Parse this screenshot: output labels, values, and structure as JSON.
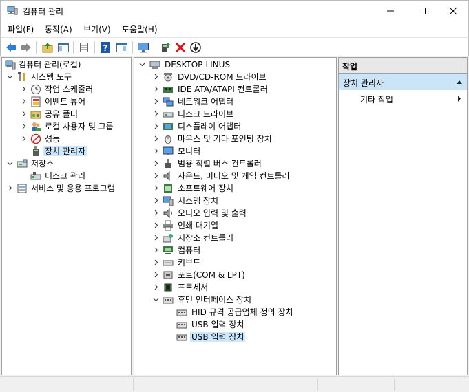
{
  "window": {
    "title": "컴퓨터 관리",
    "controls": [
      "minimize",
      "maximize",
      "close"
    ]
  },
  "menu": [
    {
      "label": "파일(F)"
    },
    {
      "label": "동작(A)"
    },
    {
      "label": "보기(V)"
    },
    {
      "label": "도움말(H)"
    }
  ],
  "toolbar": {
    "buttons": [
      "back-icon",
      "forward-icon",
      "up-icon",
      "show-hide-console-tree-icon",
      "export-list-icon",
      "help-icon",
      "show-action-pane-icon",
      "monitor-icon",
      "update-driver-icon",
      "uninstall-icon",
      "disable-device-icon"
    ]
  },
  "left_tree": [
    {
      "label": "컴퓨터 관리(로컬)",
      "icon": "computer-management-icon"
    },
    {
      "label": "시스템 도구",
      "icon": "tools-icon"
    },
    {
      "label": "작업 스케줄러",
      "icon": "clock-icon"
    },
    {
      "label": "이벤트 뷰어",
      "icon": "event-viewer-icon"
    },
    {
      "label": "공유 폴더",
      "icon": "shared-folder-icon"
    },
    {
      "label": "로컬 사용자 및 그룹",
      "icon": "users-icon"
    },
    {
      "label": "성능",
      "icon": "performance-icon"
    },
    {
      "label": "장치 관리자",
      "icon": "device-manager-icon",
      "selected": true
    },
    {
      "label": "저장소",
      "icon": "storage-icon"
    },
    {
      "label": "디스크 관리",
      "icon": "disk-management-icon"
    },
    {
      "label": "서비스 및 응용 프로그램",
      "icon": "services-icon"
    }
  ],
  "device_tree": {
    "root": "DESKTOP-LINUS",
    "categories": [
      {
        "label": "DVD/CD-ROM 드라이브",
        "icon": "dvd-drive-icon"
      },
      {
        "label": "IDE ATA/ATAPI 컨트롤러",
        "icon": "ide-controller-icon"
      },
      {
        "label": "네트워크 어댑터",
        "icon": "network-adapter-icon"
      },
      {
        "label": "디스크 드라이브",
        "icon": "disk-drive-icon"
      },
      {
        "label": "디스플레이 어댑터",
        "icon": "display-adapter-icon"
      },
      {
        "label": "마우스 및 기타 포인팅 장치",
        "icon": "mouse-icon"
      },
      {
        "label": "모니터",
        "icon": "monitor-icon"
      },
      {
        "label": "범용 직렬 버스 컨트롤러",
        "icon": "usb-controller-icon"
      },
      {
        "label": "사운드, 비디오 및 게임 컨트롤러",
        "icon": "speaker-icon"
      },
      {
        "label": "소프트웨어 장치",
        "icon": "software-device-icon"
      },
      {
        "label": "시스템 장치",
        "icon": "system-device-icon"
      },
      {
        "label": "오디오 입력 및 출력",
        "icon": "audio-io-icon"
      },
      {
        "label": "인쇄 대기열",
        "icon": "printer-icon"
      },
      {
        "label": "저장소 컨트롤러",
        "icon": "storage-controller-icon"
      },
      {
        "label": "컴퓨터",
        "icon": "computer-icon"
      },
      {
        "label": "키보드",
        "icon": "keyboard-icon"
      },
      {
        "label": "포트(COM & LPT)",
        "icon": "port-icon"
      },
      {
        "label": "프로세서",
        "icon": "processor-icon"
      },
      {
        "label": "휴먼 인터페이스 장치",
        "icon": "hid-icon"
      }
    ],
    "hid_children": [
      {
        "label": "HID 규격 공급업체 정의 장치"
      },
      {
        "label": "USB 입력 장치"
      },
      {
        "label": "USB 입력 장치",
        "selected": true
      }
    ]
  },
  "actions": {
    "header": "작업",
    "section": "장치 관리자",
    "items": [
      {
        "label": "기타 작업"
      }
    ]
  },
  "colors": {
    "selection": "#cce8ff",
    "action_section": "#cce4f7",
    "pane_border": "#a0a0a0"
  }
}
